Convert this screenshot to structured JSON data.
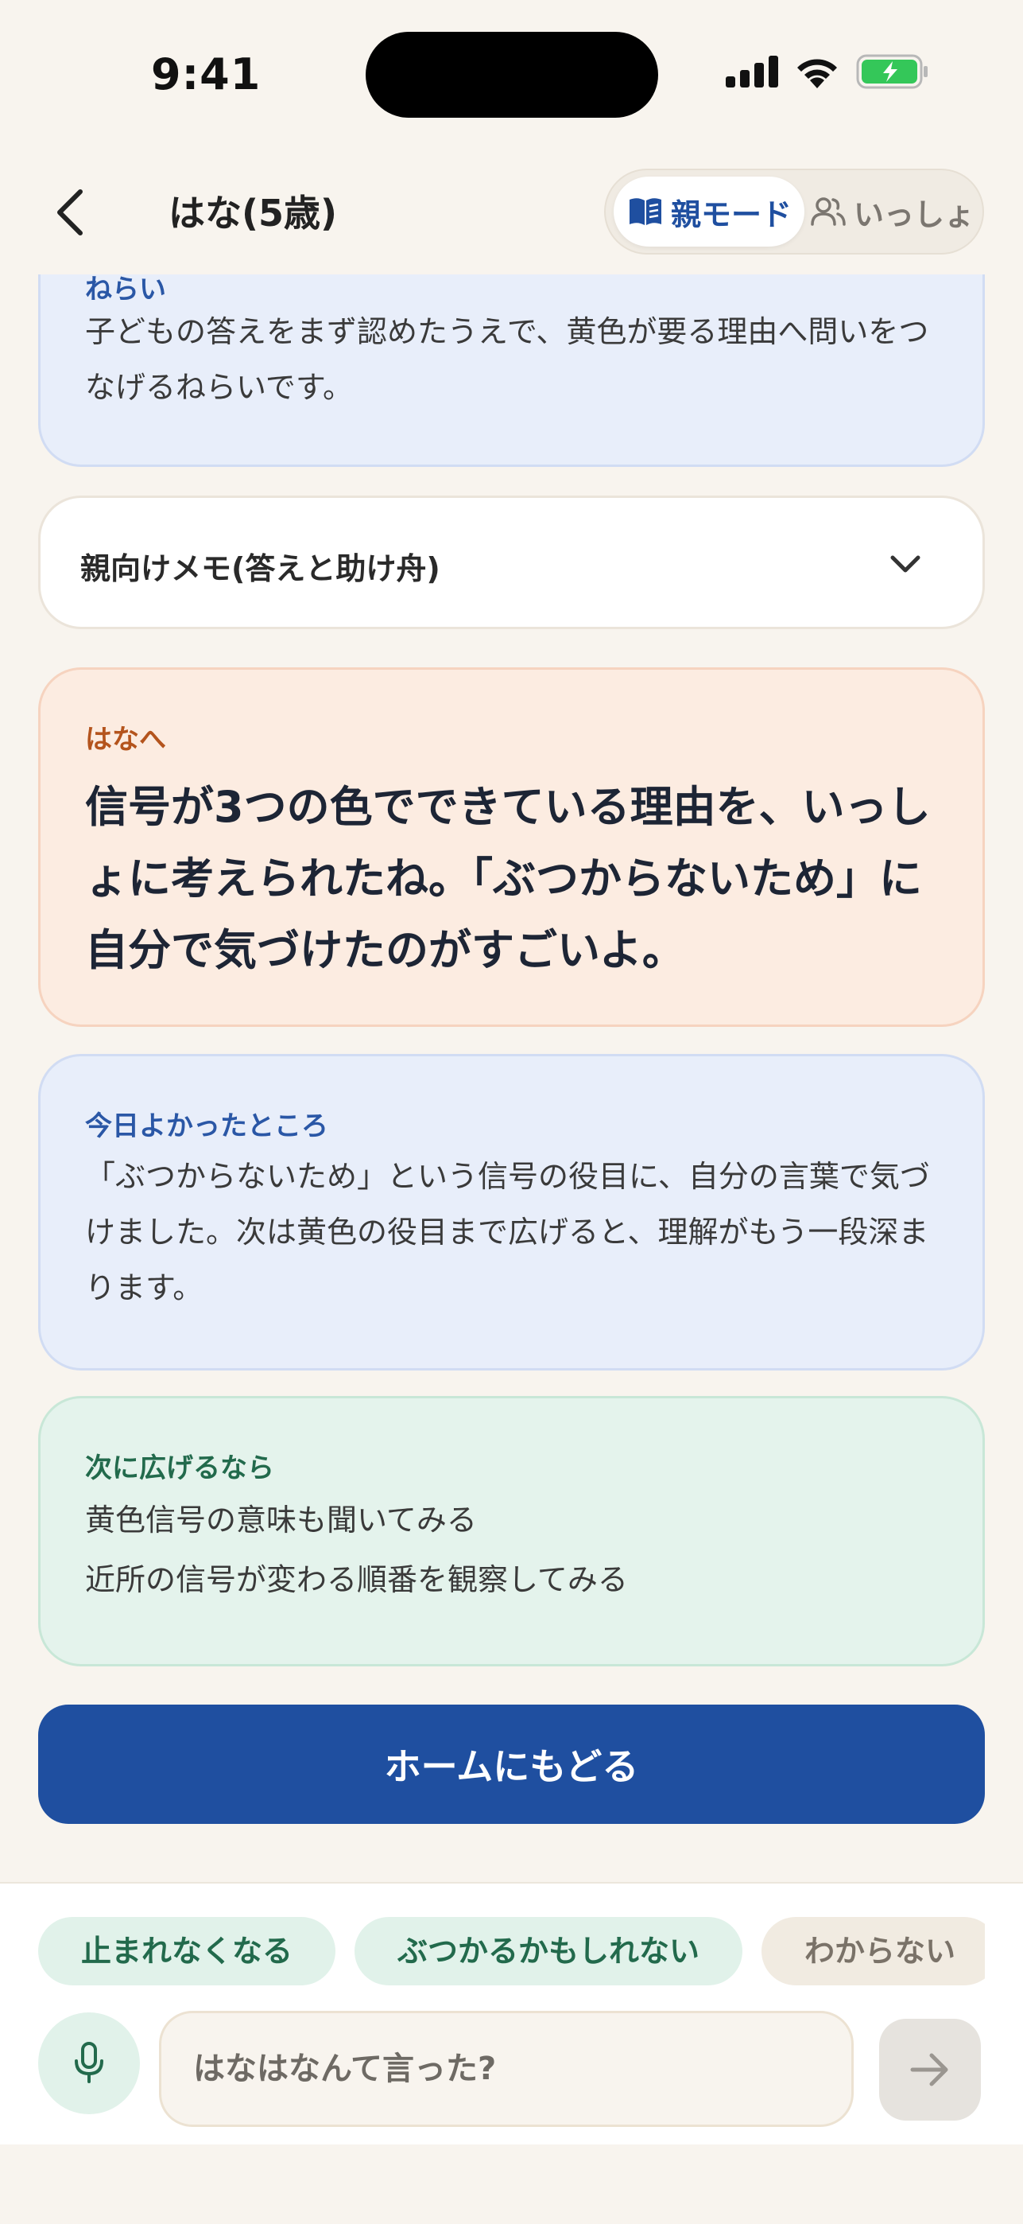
{
  "status_bar": {
    "time": "9:41"
  },
  "header": {
    "title": "はな(5歳)",
    "mode_parent_label": "親モード",
    "mode_together_label": "いっしょ"
  },
  "aim_card": {
    "label": "ねらい",
    "text": "子どもの答えをまず認めたうえで、黄色が要る理由へ問いをつなげるねらいです。"
  },
  "memo_card": {
    "title": "親向けメモ(答えと助け舟)",
    "expanded": false
  },
  "praise_card": {
    "label": "はなへ",
    "text": "信号が3つの色でできている理由を、いっしょに考えられたね。「ぶつからないため」に自分で気づけたのがすごいよ。"
  },
  "good_card": {
    "label": "今日よかったところ",
    "text": "「ぶつからないため」という信号の役目に、自分の言葉で気づけました。次は黄色の役目まで広げると、理解がもう一段深まります。"
  },
  "next_card": {
    "label": "次に広げるなら",
    "items": [
      "黄色信号の意味も聞いてみる",
      "近所の信号が変わる順番を観察してみる"
    ]
  },
  "home_button": {
    "label": "ホームにもどる"
  },
  "chips": [
    "止まれなくなる",
    "ぶつかるかもしれない",
    "わからない"
  ],
  "composer": {
    "placeholder": "はなはなんて言った?"
  },
  "colors": {
    "primary": "#1f4fa0",
    "background": "#f8f4ee",
    "blue_card": "#e8eefa",
    "orange_card": "#fcece1",
    "green_card": "#e4f3ec",
    "battery": "#34c759"
  }
}
